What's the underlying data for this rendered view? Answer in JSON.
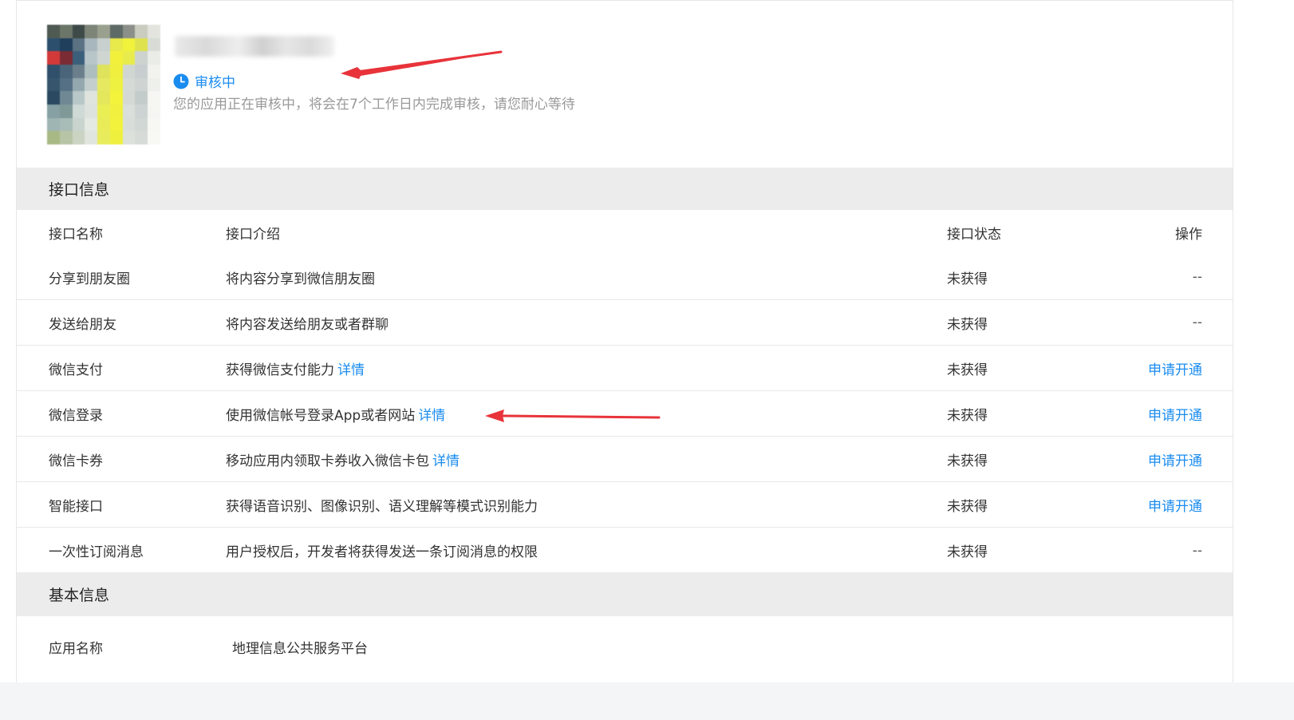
{
  "app": {
    "status_label": "审核中",
    "status_desc": "您的应用正在审核中，将会在7个工作日内完成审核，请您耐心等待",
    "status_color": "#1a8cef"
  },
  "interface_section": {
    "title": "接口信息",
    "headers": {
      "name": "接口名称",
      "desc": "接口介绍",
      "state": "接口状态",
      "op": "操作"
    },
    "rows": [
      {
        "name": "分享到朋友圈",
        "desc": "将内容分享到微信朋友圈",
        "detail": "",
        "state": "未获得",
        "op": "--"
      },
      {
        "name": "发送给朋友",
        "desc": "将内容发送给朋友或者群聊",
        "detail": "",
        "state": "未获得",
        "op": "--"
      },
      {
        "name": "微信支付",
        "desc": "获得微信支付能力",
        "detail": "详情",
        "state": "未获得",
        "op": "申请开通"
      },
      {
        "name": "微信登录",
        "desc": "使用微信帐号登录App或者网站",
        "detail": "详情",
        "state": "未获得",
        "op": "申请开通"
      },
      {
        "name": "微信卡券",
        "desc": "移动应用内领取卡券收入微信卡包",
        "detail": "详情",
        "state": "未获得",
        "op": "申请开通"
      },
      {
        "name": "智能接口",
        "desc": "获得语音识别、图像识别、语义理解等模式识别能力",
        "detail": "",
        "state": "未获得",
        "op": "申请开通"
      },
      {
        "name": "一次性订阅消息",
        "desc": "用户授权后，开发者将获得发送一条订阅消息的权限",
        "detail": "",
        "state": "未获得",
        "op": "--"
      }
    ]
  },
  "basic_section": {
    "title": "基本信息",
    "app_name_label": "应用名称",
    "app_name_value": "地理信息公共服务平台"
  },
  "colors": {
    "link": "#1a8cef",
    "annotation_arrow": "#e8333a",
    "section_bg": "#ececec"
  }
}
